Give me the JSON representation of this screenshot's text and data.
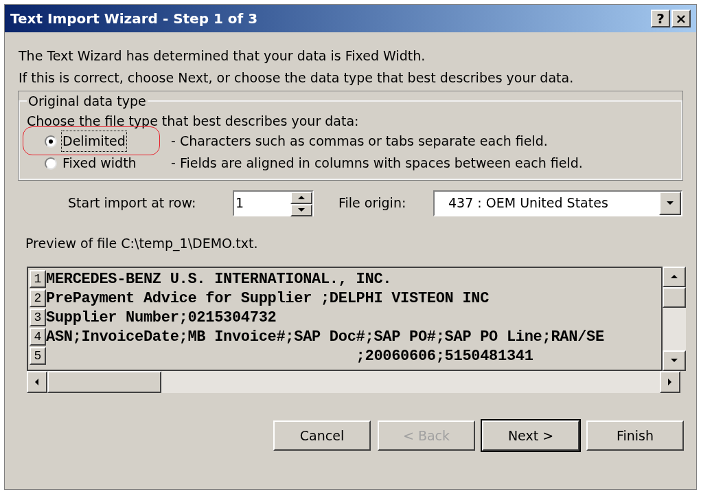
{
  "window": {
    "title": "Text Import Wizard - Step 1 of 3",
    "title_buttons": [
      "?",
      "×"
    ]
  },
  "intro": [
    "The Text Wizard has determined that your data is Fixed Width.",
    "If this is correct, choose Next, or choose the data type that best describes your data."
  ],
  "data_type_group": {
    "legend": "Original data type",
    "prompt": "Choose the file type that best describes your data:",
    "options": [
      {
        "label": "Delimited",
        "description": "- Characters such as commas or tabs separate each field.",
        "selected": true,
        "highlighted": true
      },
      {
        "label": "Fixed width",
        "description": "- Fields are aligned in columns with spaces between each field.",
        "selected": false,
        "highlighted": false
      }
    ]
  },
  "start_row": {
    "label": "Start import at row:",
    "value": "1"
  },
  "file_origin": {
    "label": "File origin:",
    "value": "437 : OEM United States"
  },
  "preview": {
    "label": "Preview of file C:\\temp_1\\DEMO.txt.",
    "rows": [
      {
        "number": "1",
        "text": "MERCEDES-BENZ U.S. INTERNATIONAL., INC."
      },
      {
        "number": "2",
        "text": "PrePayment Advice for Supplier ;DELPHI VISTEON INC"
      },
      {
        "number": "3",
        "text": "Supplier Number;0215304732"
      },
      {
        "number": "4",
        "text": "ASN;InvoiceDate;MB Invoice#;SAP Doc#;SAP PO#;SAP PO Line;RAN/SE"
      },
      {
        "number": "5",
        "text": "                                   ;20060606;5150481341"
      }
    ]
  },
  "buttons": [
    {
      "label": "Cancel",
      "disabled": false,
      "default": false
    },
    {
      "label": "< Back",
      "disabled": true,
      "default": false
    },
    {
      "label": "Next >",
      "disabled": false,
      "default": true
    },
    {
      "label": "Finish",
      "disabled": false,
      "default": false
    }
  ]
}
